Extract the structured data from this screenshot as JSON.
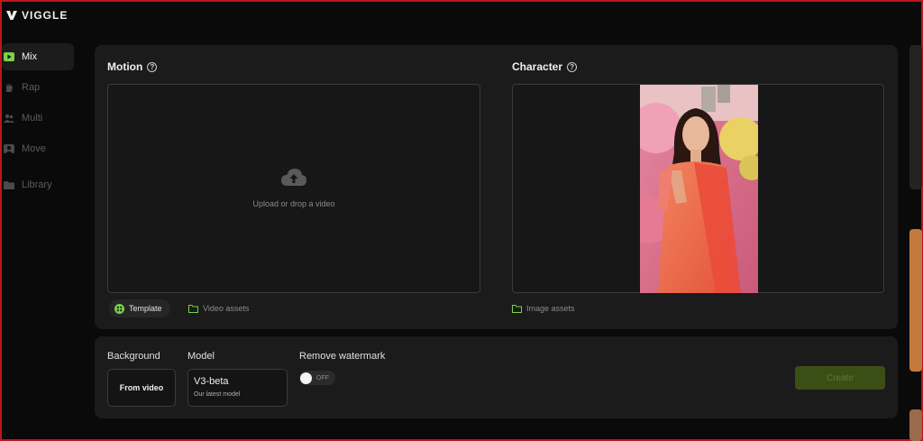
{
  "app": {
    "name": "VIGGLE"
  },
  "sidebar": {
    "items": [
      {
        "label": "Mix",
        "active": true
      },
      {
        "label": "Rap",
        "active": false
      },
      {
        "label": "Multi",
        "active": false
      },
      {
        "label": "Move",
        "active": false
      },
      {
        "label": "Library",
        "active": false
      }
    ]
  },
  "motion": {
    "title": "Motion",
    "upload_text": "Upload or drop a video",
    "tabs": [
      {
        "label": "Template",
        "selected": true
      },
      {
        "label": "Video assets",
        "selected": false
      }
    ]
  },
  "character": {
    "title": "Character",
    "assets_label": "Image assets"
  },
  "settings": {
    "background": {
      "label": "Background",
      "value": "From video"
    },
    "model": {
      "label": "Model",
      "value": "V3-beta",
      "description": "Our latest model"
    },
    "watermark": {
      "label": "Remove watermark",
      "state": "OFF"
    },
    "create_label": "Create"
  },
  "colors": {
    "accent": "#7ad14a",
    "create_bg": "#3a4f16",
    "panel": "#1b1b1c",
    "frame_border": "#c0141c"
  }
}
